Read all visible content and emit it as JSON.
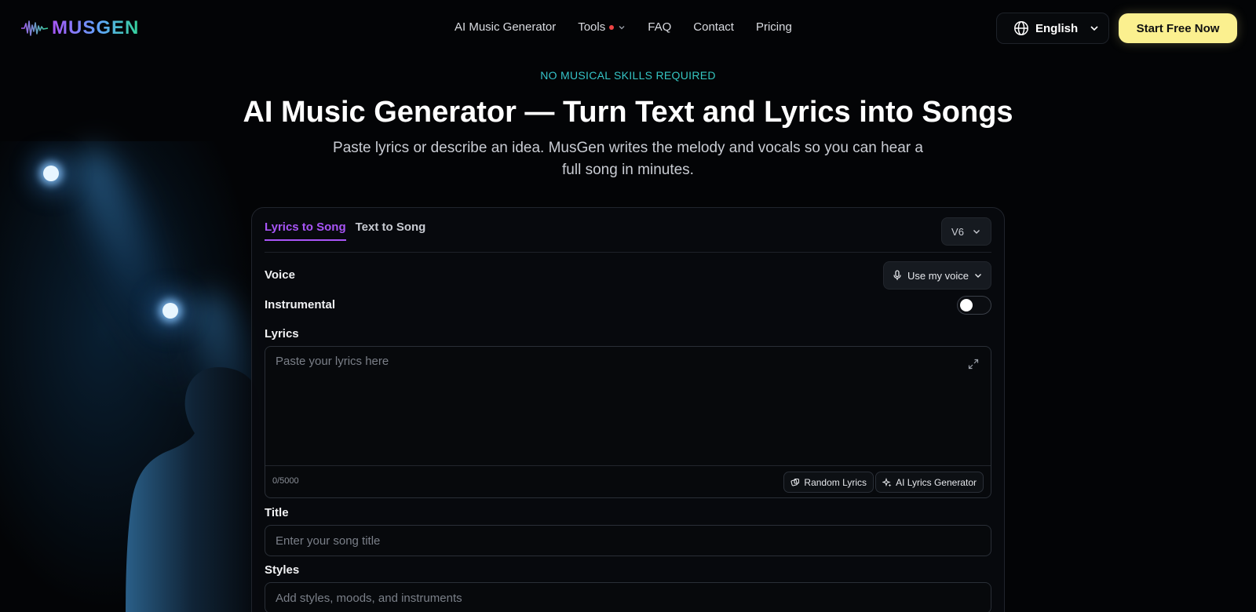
{
  "brand": {
    "logo_text": "MUSGEN"
  },
  "nav": {
    "items": [
      "AI Music Generator",
      "Tools",
      "FAQ",
      "Contact",
      "Pricing"
    ]
  },
  "header": {
    "language": "English",
    "cta": "Start Free Now"
  },
  "hero": {
    "eyebrow": "NO MUSICAL SKILLS REQUIRED",
    "title": "AI Music Generator — Turn Text and Lyrics into Songs",
    "subtitle": "Paste lyrics or describe an idea. MusGen writes the melody and vocals so you can hear a full song in minutes."
  },
  "generator": {
    "tabs": [
      "Lyrics to Song",
      "Text to Song"
    ],
    "active_tab": "Lyrics to Song",
    "version": "V6",
    "voice_label": "Voice",
    "voice_button": "Use my voice",
    "instrumental_label": "Instrumental",
    "instrumental_on": false,
    "lyrics_label": "Lyrics",
    "lyrics_placeholder": "Paste your lyrics here",
    "lyrics_counter": "0/5000",
    "random_lyrics": "Random Lyrics",
    "ai_lyrics": "AI Lyrics Generator",
    "title_label": "Title",
    "title_placeholder": "Enter your song title",
    "styles_label": "Styles",
    "styles_placeholder": "Add styles, moods, and instruments"
  },
  "colors": {
    "accent_purple": "#a855f7",
    "cta_yellow": "#fbf08f",
    "eyebrow_teal": "#2dd4bf",
    "background": "#030406"
  }
}
